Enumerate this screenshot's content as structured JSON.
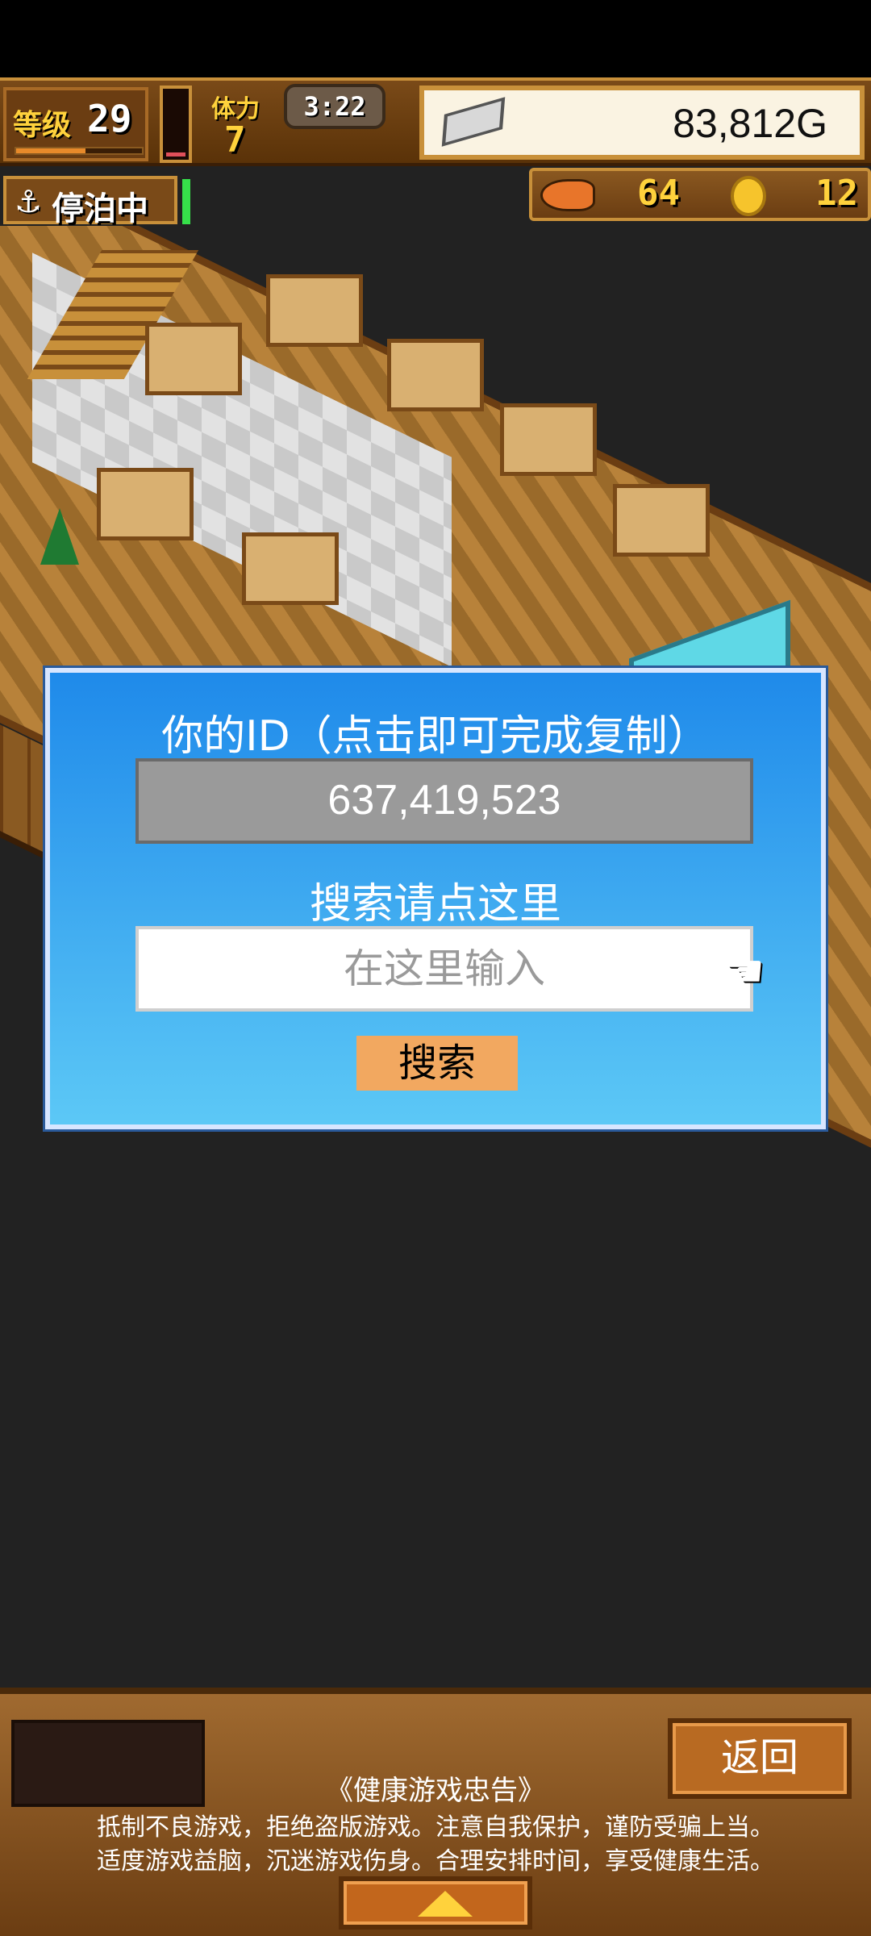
{
  "hud": {
    "level_label": "等级",
    "level_value": "29",
    "level_progress": 0.55,
    "stamina_fill": 0.15,
    "stamina_label": "体力",
    "stamina_value": "7",
    "timer": "3:22",
    "gold": "83,812G",
    "docked_label": "停泊中",
    "fish_count": "64",
    "coin_count": "12"
  },
  "dialog": {
    "title": "你的ID（点击即可完成复制）",
    "id_value": "637,419,523",
    "search_hint": "搜索请点这里",
    "search_placeholder": "在这里输入",
    "search_button": "搜索"
  },
  "bottom": {
    "back_button": "返回",
    "notice_title": "《健康游戏忠告》",
    "notice_line1": "抵制不良游戏，拒绝盗版游戏。注意自我保护，谨防受骗上当。",
    "notice_line2": "适度游戏益脑，沉迷游戏伤身。合理安排时间，享受健康生活。"
  },
  "colors": {
    "dialog_top": "#1f8aea",
    "dialog_bottom": "#5cc8f6",
    "search_button": "#f2a860",
    "wood": "#7a4a18",
    "docked_indicator": "#36e04a"
  }
}
